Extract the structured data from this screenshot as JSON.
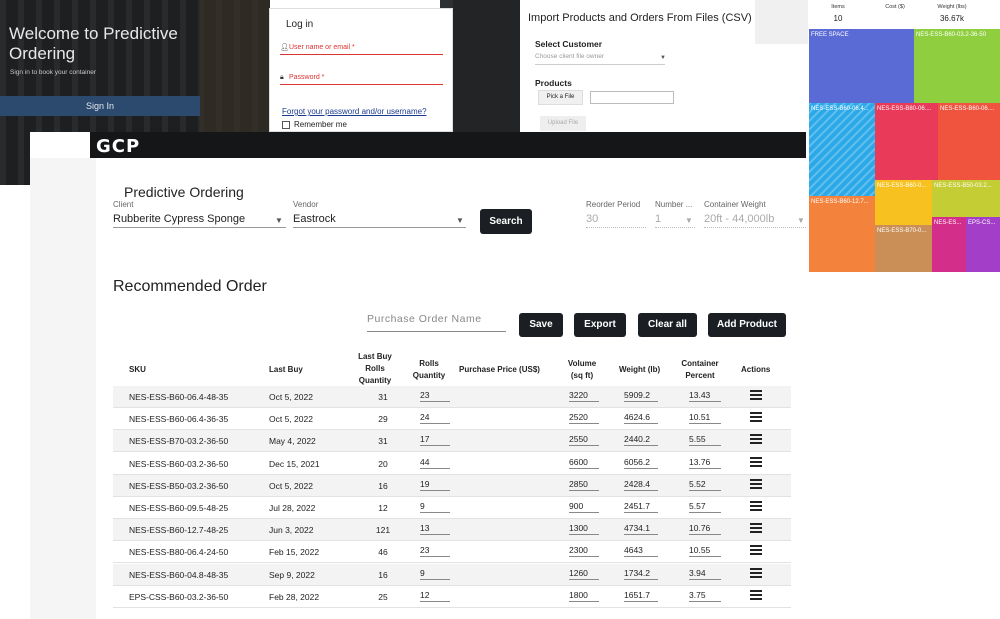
{
  "welcome": {
    "title": "Welcome to Predictive Ordering",
    "subtitle": "Sign in to book your container",
    "sign_in": "Sign In"
  },
  "login": {
    "title": "Log in",
    "username_placeholder": "User name or email *",
    "password_placeholder": "Password *",
    "forgot": "Forgot your password and/or username?",
    "remember": "Remember me"
  },
  "import": {
    "title": "Import Products and Orders From Files (CSV)",
    "customer_label": "Select Customer",
    "customer_placeholder": "Choose client file owner",
    "products_label": "Products",
    "pick_file": "Pick a File",
    "upload_file": "Upload File"
  },
  "treemap": {
    "headers": [
      "Items",
      "Cost ($)",
      "Weight (lbs)"
    ],
    "values": [
      "10",
      "",
      "36.67k"
    ],
    "cells": [
      {
        "label": "FREE SPACE",
        "color": "#5b6bd6"
      },
      {
        "label": "NES-ESS-B60-03.2-36-50",
        "color": "#8fcf3f"
      },
      {
        "label": "NES-ESS-B60-06.4...",
        "color": "#2aa8e8"
      },
      {
        "label": "NES-ESS-B80-06....",
        "color": "#e93a5a"
      },
      {
        "label": "NES-ESS-B60-06....",
        "color": "#f0543f"
      },
      {
        "label": "NES-ESS-B60-12.7...",
        "color": "#f3823c"
      },
      {
        "label": "NES-ESS-B60-0...",
        "color": "#f7c21f"
      },
      {
        "label": "NES-ESS-B50-03.2...",
        "color": "#c5cd35"
      },
      {
        "label": "NES-ESS-B70-0...",
        "color": "#c98f57"
      },
      {
        "label": "NES-ES...",
        "color": "#d22e8a"
      },
      {
        "label": "EPS-CS...",
        "color": "#a23ec8"
      }
    ]
  },
  "app": {
    "logo": "GCP",
    "page_title": "Predictive Ordering",
    "filters": {
      "client_label": "Client",
      "client_value": "Rubberite Cypress Sponge",
      "vendor_label": "Vendor",
      "vendor_value": "Eastrock",
      "search": "Search",
      "reorder_label": "Reorder Period",
      "reorder_value": "30",
      "number_label": "Number ...",
      "number_value": "1",
      "container_label": "Container Weight",
      "container_value": "20ft - 44,000lb"
    },
    "recommended_title": "Recommended Order",
    "po_placeholder": "Purchase Order Name",
    "actions": {
      "save": "Save",
      "export": "Export",
      "clear": "Clear all",
      "add": "Add Product"
    },
    "columns": {
      "sku": "SKU",
      "last_buy": "Last Buy",
      "last_buy_qty": "Last Buy Rolls Quantity",
      "rolls_qty": "Rolls Quantity",
      "price": "Purchase Price (US$)",
      "volume": "Volume (sq ft)",
      "weight": "Weight (lb)",
      "percent": "Container Percent",
      "actions": "Actions"
    },
    "rows": [
      {
        "sku": "NES-ESS-B60-06.4-48-35",
        "last_buy": "Oct 5, 2022",
        "last_qty": "31",
        "qty": "23",
        "volume": "3220",
        "weight": "5909.2",
        "percent": "13.43"
      },
      {
        "sku": "NES-ESS-B60-06.4-36-35",
        "last_buy": "Oct 5, 2022",
        "last_qty": "29",
        "qty": "24",
        "volume": "2520",
        "weight": "4624.6",
        "percent": "10.51"
      },
      {
        "sku": "NES-ESS-B70-03.2-36-50",
        "last_buy": "May 4, 2022",
        "last_qty": "31",
        "qty": "17",
        "volume": "2550",
        "weight": "2440.2",
        "percent": "5.55"
      },
      {
        "sku": "NES-ESS-B60-03.2-36-50",
        "last_buy": "Dec 15, 2021",
        "last_qty": "20",
        "qty": "44",
        "volume": "6600",
        "weight": "6056.2",
        "percent": "13.76"
      },
      {
        "sku": "NES-ESS-B50-03.2-36-50",
        "last_buy": "Oct 5, 2022",
        "last_qty": "16",
        "qty": "19",
        "volume": "2850",
        "weight": "2428.4",
        "percent": "5.52"
      },
      {
        "sku": "NES-ESS-B60-09.5-48-25",
        "last_buy": "Jul 28, 2022",
        "last_qty": "12",
        "qty": "9",
        "volume": "900",
        "weight": "2451.7",
        "percent": "5.57"
      },
      {
        "sku": "NES-ESS-B60-12.7-48-25",
        "last_buy": "Jun 3, 2022",
        "last_qty": "121",
        "qty": "13",
        "volume": "1300",
        "weight": "4734.1",
        "percent": "10.76"
      },
      {
        "sku": "NES-ESS-B80-06.4-24-50",
        "last_buy": "Feb 15, 2022",
        "last_qty": "46",
        "qty": "23",
        "volume": "2300",
        "weight": "4643",
        "percent": "10.55"
      },
      {
        "sku": "NES-ESS-B60-04.8-48-35",
        "last_buy": "Sep 9, 2022",
        "last_qty": "16",
        "qty": "9",
        "volume": "1260",
        "weight": "1734.2",
        "percent": "3.94"
      },
      {
        "sku": "EPS-CSS-B60-03.2-36-50",
        "last_buy": "Feb 28, 2022",
        "last_qty": "25",
        "qty": "12",
        "volume": "1800",
        "weight": "1651.7",
        "percent": "3.75"
      }
    ]
  }
}
